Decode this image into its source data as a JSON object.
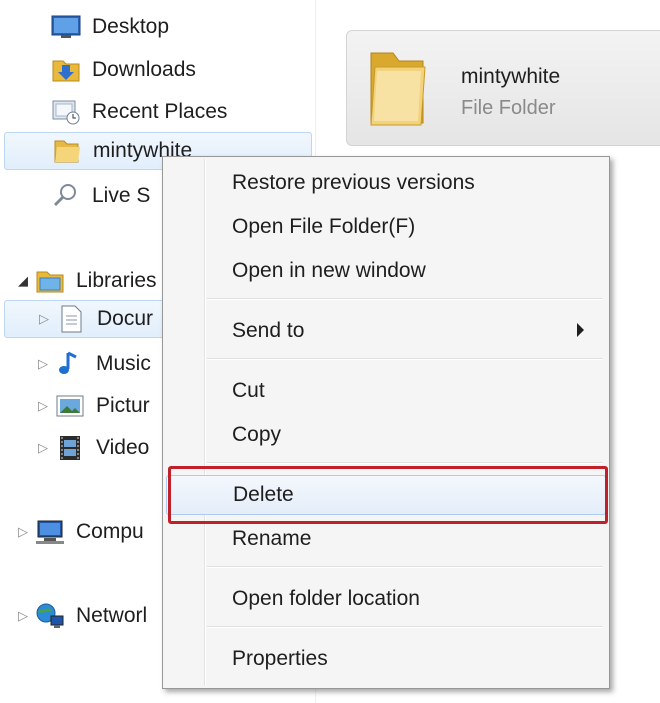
{
  "nav": {
    "favorites": [
      {
        "label": "Desktop",
        "icon": "desktop-icon"
      },
      {
        "label": "Downloads",
        "icon": "downloads-icon"
      },
      {
        "label": "Recent Places",
        "icon": "recent-places-icon"
      },
      {
        "label": "mintywhite",
        "icon": "folder-icon"
      },
      {
        "label": "Live S",
        "icon": "search-icon"
      }
    ],
    "libraries": {
      "label": "Libraries",
      "icon": "libraries-icon"
    },
    "library_items": [
      {
        "label": "Docur",
        "icon": "documents-icon"
      },
      {
        "label": "Music",
        "icon": "music-icon"
      },
      {
        "label": "Pictur",
        "icon": "pictures-icon"
      },
      {
        "label": "Video",
        "icon": "videos-icon"
      }
    ],
    "computer": {
      "label": "Compu",
      "icon": "computer-icon"
    },
    "network": {
      "label": "Networl",
      "icon": "network-icon"
    }
  },
  "content": {
    "item_name": "mintywhite",
    "item_type": "File Folder"
  },
  "menu": {
    "items": [
      {
        "label": "Restore previous versions"
      },
      {
        "label": "Open File Folder(F)"
      },
      {
        "label": "Open in new window"
      },
      {
        "label": "Send to",
        "has_submenu": true
      },
      {
        "label": "Cut"
      },
      {
        "label": "Copy"
      },
      {
        "label": "Delete",
        "hover": true
      },
      {
        "label": "Rename"
      },
      {
        "label": "Open folder location"
      },
      {
        "label": "Properties"
      }
    ]
  },
  "colors": {
    "highlight_outline": "#c0202a",
    "selection_border": "#bcd6f3",
    "hover_border": "#aecbef"
  }
}
